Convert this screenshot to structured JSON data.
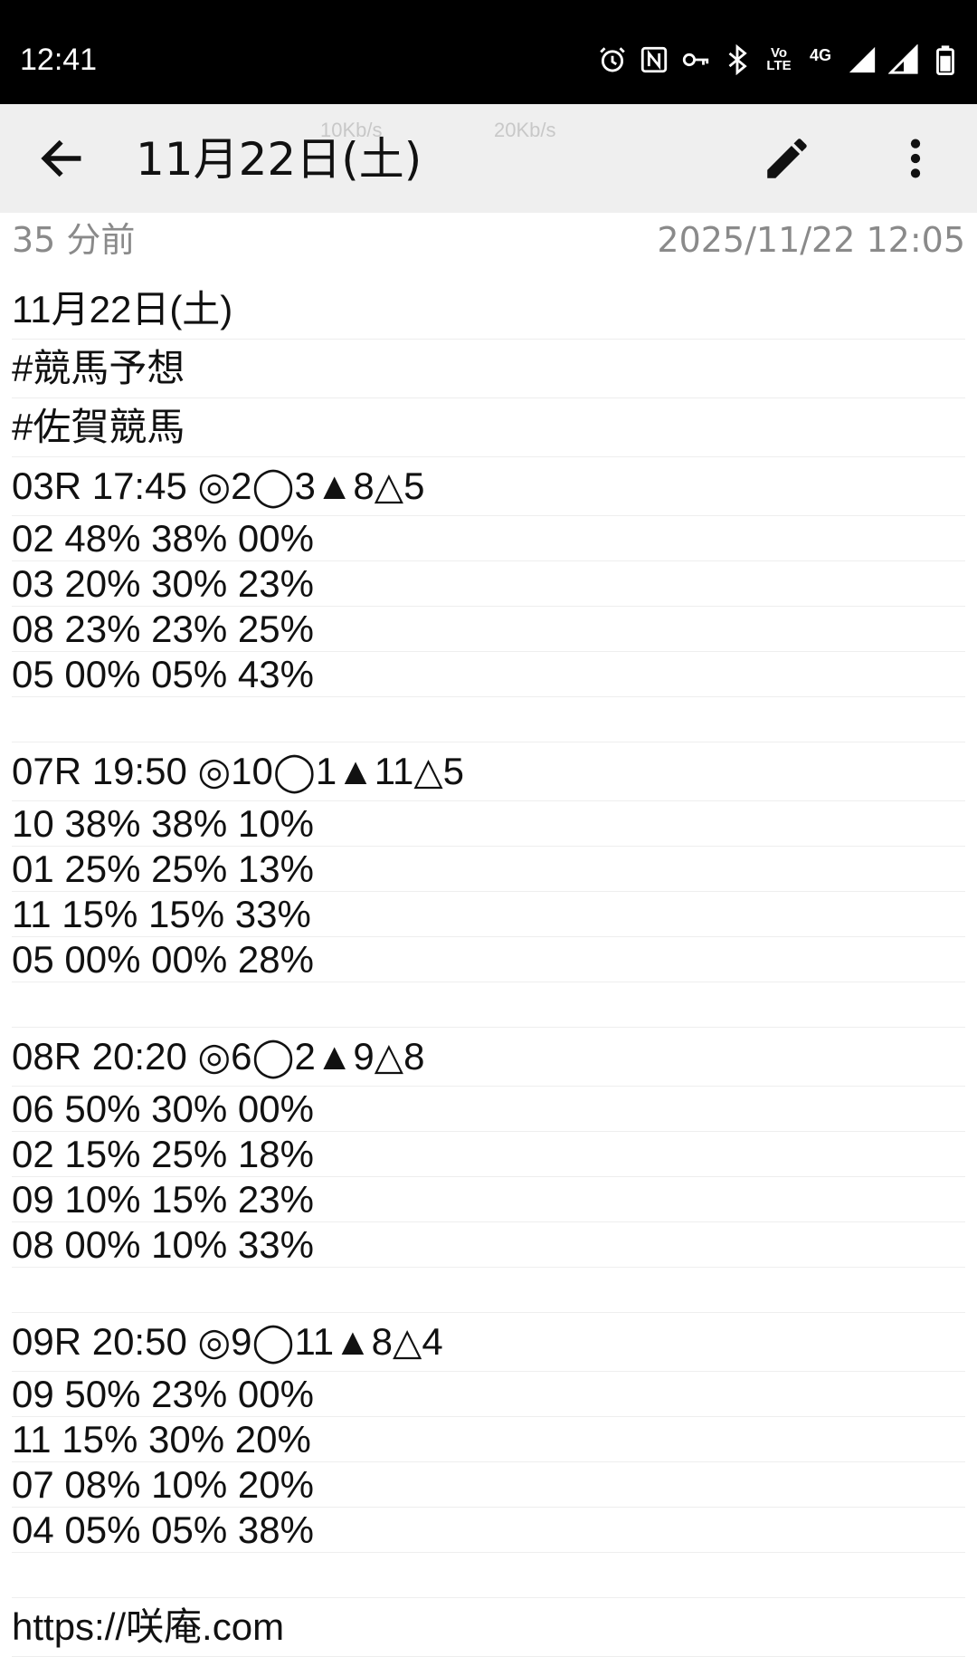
{
  "status_bar": {
    "time": "12:41",
    "icons": [
      "alarm-icon",
      "nfc-icon",
      "vpn-key-icon",
      "bluetooth-icon",
      "volte-icon",
      "4g-icon",
      "signal-icon",
      "signal-icon-2",
      "battery-icon"
    ],
    "volte_label": "Vo LTE",
    "network_label": "4G"
  },
  "app_bar": {
    "title": "11月22日(土)",
    "speed_1": "10Kb/s",
    "speed_2": "20Kb/s",
    "background": "#efefef"
  },
  "note_meta": {
    "relative_time": "35 分前",
    "datetime": "2025/11/22 12:05"
  },
  "note": {
    "title_line": "11月22日(土)",
    "tags": [
      "#競馬予想",
      "#佐賀競馬"
    ],
    "races": [
      {
        "header": "03R 17:45 ◎2◯3▲8△5",
        "rows": [
          "02 48% 38% 00%",
          "03 20% 30% 23%",
          "08 23% 23% 25%",
          "05 00% 05% 43%"
        ]
      },
      {
        "header": "07R 19:50 ◎10◯1▲11△5",
        "rows": [
          "10 38% 38% 10%",
          "01 25% 25% 13%",
          "11 15% 15% 33%",
          "05 00% 00% 28%"
        ]
      },
      {
        "header": "08R 20:20 ◎6◯2▲9△8",
        "rows": [
          "06 50% 30% 00%",
          "02 15% 25% 18%",
          "09 10% 15% 23%",
          "08 00% 10% 33%"
        ]
      },
      {
        "header": "09R 20:50 ◎9◯11▲8△4",
        "rows": [
          "09 50% 23% 00%",
          "11 15% 30% 20%",
          "07 08% 10% 20%",
          "04 05% 05% 38%"
        ]
      }
    ],
    "footer_url": "https://咲庵.com"
  }
}
